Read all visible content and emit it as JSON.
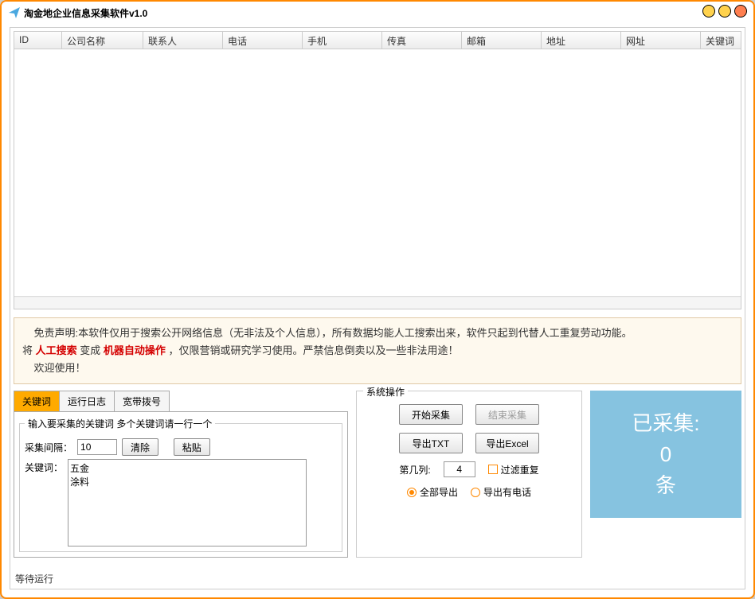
{
  "window": {
    "title": "淘金地企业信息采集软件v1.0"
  },
  "table": {
    "columns": [
      "ID",
      "公司名称",
      "联系人",
      "电话",
      "手机",
      "传真",
      "邮箱",
      "地址",
      "网址",
      "关键词"
    ]
  },
  "notice": {
    "line1_a": "免责声明:本软件仅用于搜索公开网络信息（无非法及个人信息），所有数据均能人工搜索出来，软件只起到代替人工重复劳动功能。",
    "line2_a": "将 ",
    "red1": "人工搜索",
    "line2_b": " 变成 ",
    "red2": "机器自动操作",
    "line2_c": " ，仅限营销或研究学习使用。严禁信息倒卖以及一些非法用途！",
    "line3": "欢迎使用！"
  },
  "tabs": {
    "keyword": "关键词",
    "log": "运行日志",
    "dial": "宽带拨号"
  },
  "keyword_panel": {
    "hint": "输入要采集的关键词 多个关键词请一行一个",
    "interval_label": "采集间隔：",
    "interval_value": "10",
    "clear": "清除",
    "paste": "粘贴",
    "kw_label": "关键词：",
    "kw_value": "五金\n涂料"
  },
  "sysop": {
    "title": "系统操作",
    "start": "开始采集",
    "stop": "结束采集",
    "export_txt": "导出TXT",
    "export_excel": "导出Excel",
    "col_label": "第几列:",
    "col_value": "4",
    "filter_dup": "过滤重复",
    "export_all": "全部导出",
    "export_phone": "导出有电话"
  },
  "counter": {
    "label1": "已采集:",
    "count": "0",
    "label2": "条"
  },
  "status": "等待运行"
}
